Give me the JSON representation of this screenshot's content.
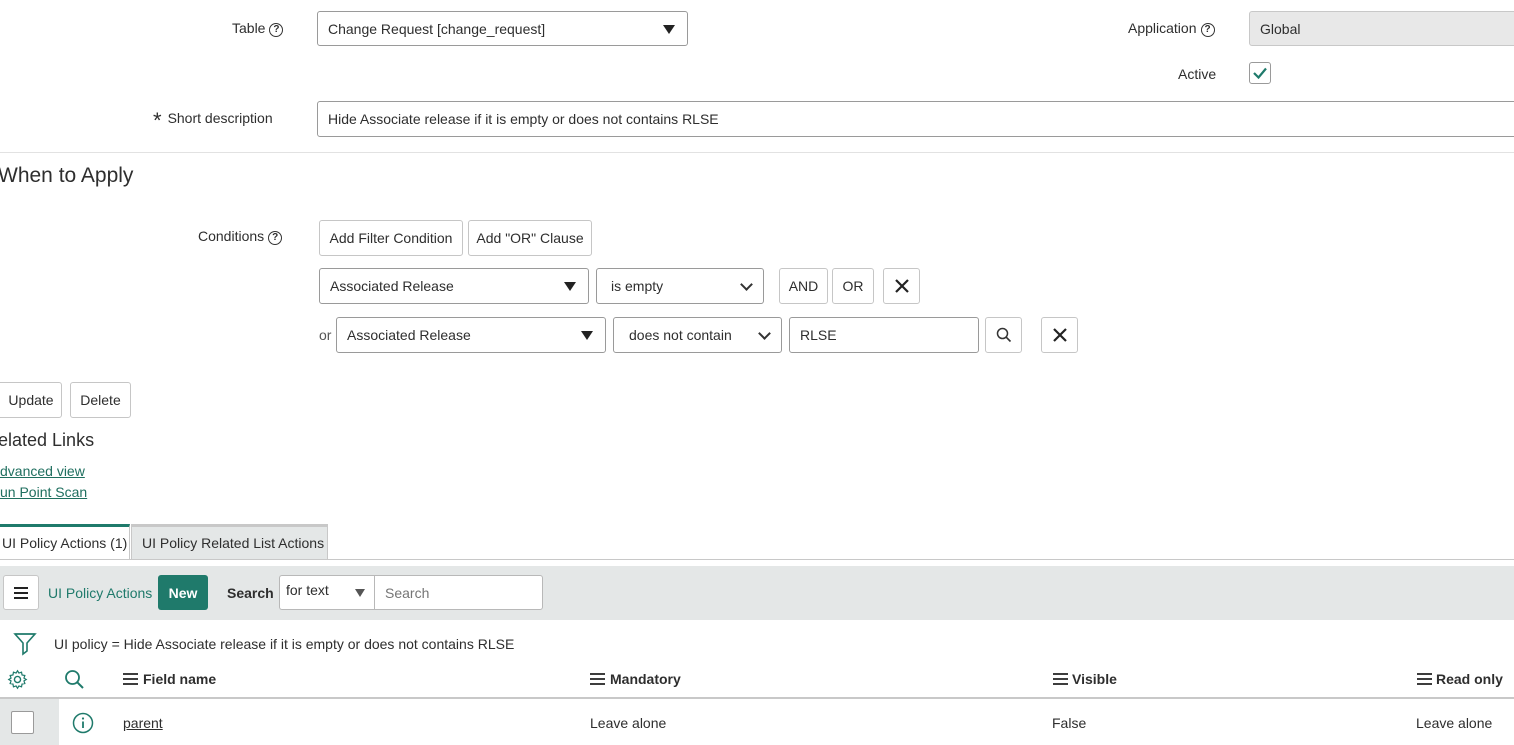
{
  "form": {
    "table_label": "Table",
    "table_value": "Change Request [change_request]",
    "application_label": "Application",
    "application_value": "Global",
    "active_label": "Active",
    "short_description_label": "Short description",
    "short_description_value": "Hide Associate release if it is empty or does not contains RLSE"
  },
  "when_to_apply": {
    "heading": "When to Apply",
    "conditions_label": "Conditions",
    "add_filter_label": "Add Filter Condition",
    "add_or_label": "Add \"OR\" Clause",
    "rows": [
      {
        "prefix": "",
        "field": "Associated Release",
        "operator": "is empty",
        "and_label": "AND",
        "or_label": "OR"
      },
      {
        "prefix": "or",
        "field": "Associated Release",
        "operator": "does not contain",
        "value": "RLSE"
      }
    ]
  },
  "actions": {
    "update_label": "Update",
    "delete_label": "Delete"
  },
  "related_links": {
    "heading": "elated Links",
    "links": [
      "dvanced view",
      "un Point Scan"
    ]
  },
  "tabs": [
    {
      "label": "UI Policy Actions (1)",
      "active": true
    },
    {
      "label": "UI Policy Related List Actions",
      "active": false
    }
  ],
  "list": {
    "title": "UI Policy Actions",
    "new_label": "New",
    "search_label": "Search",
    "search_scope": "for text",
    "search_placeholder": "Search",
    "breadcrumb": "UI policy = Hide Associate release if it is empty or does not contains RLSE",
    "columns": [
      "Field name",
      "Mandatory",
      "Visible",
      "Read only"
    ],
    "rows": [
      {
        "field_name": "parent",
        "mandatory": "Leave alone",
        "visible": "False",
        "read_only": "Leave alone"
      }
    ]
  },
  "colors": {
    "accent": "#1f7a6b",
    "list_header_bg": "#e4e7e7",
    "link": "#1f6f5f"
  }
}
